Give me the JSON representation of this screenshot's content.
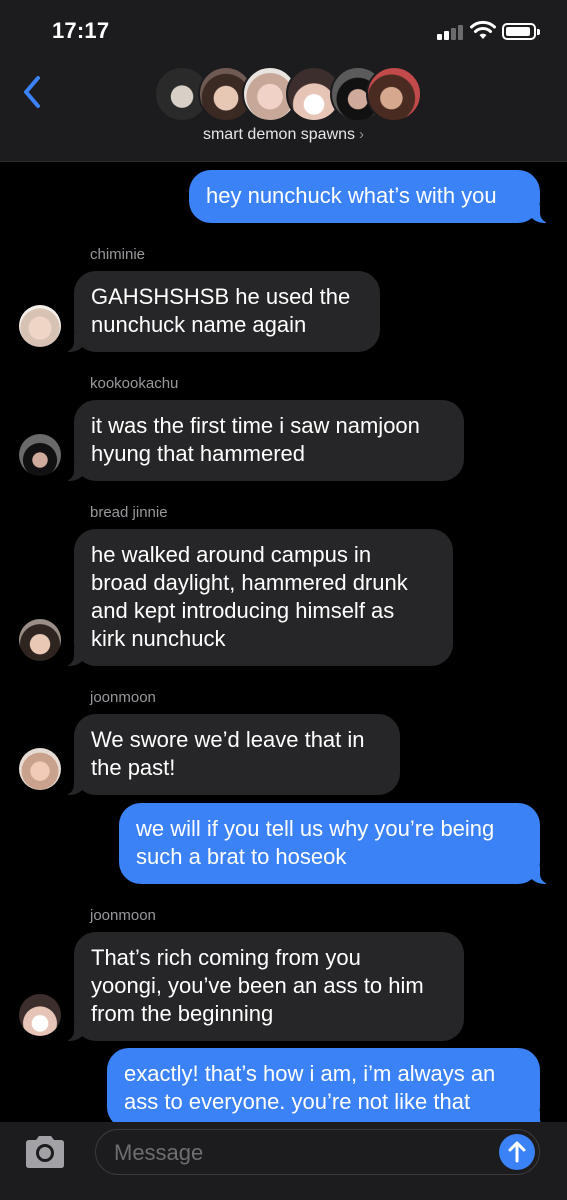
{
  "status_bar": {
    "time": "17:17"
  },
  "header": {
    "group_name": "smart demon spawns",
    "chevron": "›"
  },
  "messages": [
    {
      "direction": "out",
      "text": "hey nunchuck what’s with you"
    },
    {
      "direction": "in",
      "sender": "chiminie",
      "text": "GAHSHSHSB he used the\nnunchuck name again"
    },
    {
      "direction": "in",
      "sender": "kookookachu",
      "text": "it was the first time i saw namjoon\nhyung that hammered"
    },
    {
      "direction": "in",
      "sender": "bread jinnie",
      "text": "he walked around campus in\nbroad daylight, hammered drunk\nand kept introducing himself as\nkirk nunchuck"
    },
    {
      "direction": "in",
      "sender": "joonmoon",
      "text": "We swore we’d leave that in\nthe past!"
    },
    {
      "direction": "out",
      "text": "we will if you tell us why you’re being\nsuch a brat to hoseok"
    },
    {
      "direction": "in",
      "sender": "joonmoon",
      "text": "That’s rich coming from you\nyoongi, you’ve been an ass to him\nfrom the beginning"
    },
    {
      "direction": "out",
      "text": "exactly! that’s how i am, i’m always an\nass to everyone. you’re not like that"
    }
  ],
  "input": {
    "placeholder": "Message"
  },
  "icons": {
    "back": "chevron-left-icon",
    "camera": "camera-icon",
    "send": "arrow-up-icon",
    "signal": "cellular-signal-icon",
    "wifi": "wifi-icon",
    "battery": "battery-icon"
  },
  "colors": {
    "accent": "#3b82f6",
    "incoming_bubble": "#262628",
    "bar_background": "#1c1c1e",
    "background": "#000000"
  }
}
